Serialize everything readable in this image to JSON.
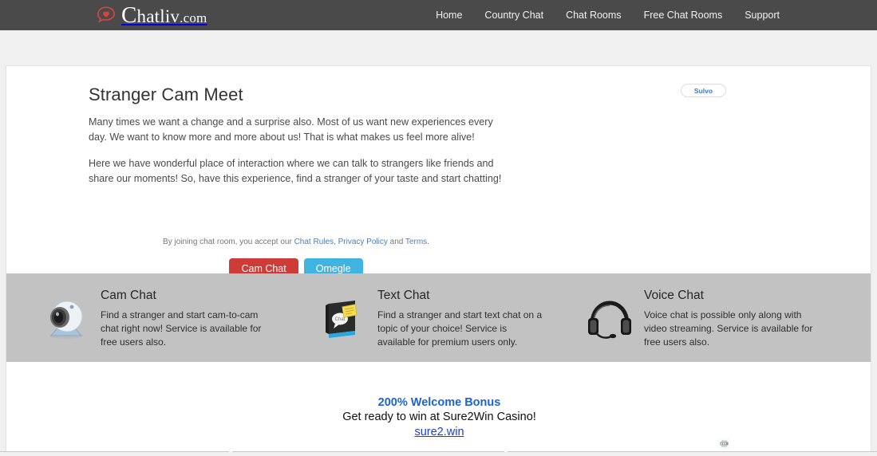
{
  "header": {
    "brand": {
      "cap": "C",
      "name": "hatliv",
      "tld": ".com",
      "icon": "heart-speech-bubble-icon"
    },
    "nav": [
      {
        "label": "Home"
      },
      {
        "label": "Country Chat"
      },
      {
        "label": "Chat Rooms"
      },
      {
        "label": "Free Chat Rooms"
      },
      {
        "label": "Support"
      }
    ]
  },
  "hero": {
    "title": "Stranger Cam Meet",
    "paragraph1": "Many times we want a change and a surprise also. Most of us want new experiences every day. We want to know more and more about us! That is what makes us feel more alive!",
    "paragraph2": "Here we have wonderful place of interaction where we can talk to strangers like friends and share our moments! So, have this experience, find a stranger of your taste and start chatting!",
    "disclaimer": {
      "prefix": "By joining chat room, you accept our ",
      "link_rules": "Chat Rules",
      "sep1": ", ",
      "link_privacy": "Privacy Policy",
      "sep2": " and ",
      "link_terms": "Terms",
      "suffix": "."
    },
    "buttons": {
      "cam_chat": "Cam Chat",
      "omegle": "Omegle"
    }
  },
  "ad_badge": {
    "label": "Sulvo"
  },
  "features": [
    {
      "icon": "webcam-icon",
      "title": "Cam Chat",
      "description": "Find a stranger and start cam-to-cam chat right now! Service is available for free users also."
    },
    {
      "icon": "text-chat-book-icon",
      "title": "Text Chat",
      "description": "Find a stranger and start text chat on a topic of your choice! Service is available for premium users only."
    },
    {
      "icon": "headset-icon",
      "title": "Voice Chat",
      "description": "Voice chat is possible only along with video streaming. Service is available for free users also."
    }
  ],
  "ad": {
    "bonus": "200% Welcome Bonus",
    "subtitle": "Get ready to win at Sure2Win Casino!",
    "link": "sure2.win",
    "adchoices_icon": "adchoices-icon"
  },
  "colors": {
    "header_bg": "#4a4a4a",
    "page_bg": "#f0f0f0",
    "features_bg": "#c2c2c2",
    "cam_button": "#cf3b36",
    "omegle_button": "#40b3e0",
    "link_blue": "#4a7ebb",
    "ad_blue": "#1a62d6"
  }
}
